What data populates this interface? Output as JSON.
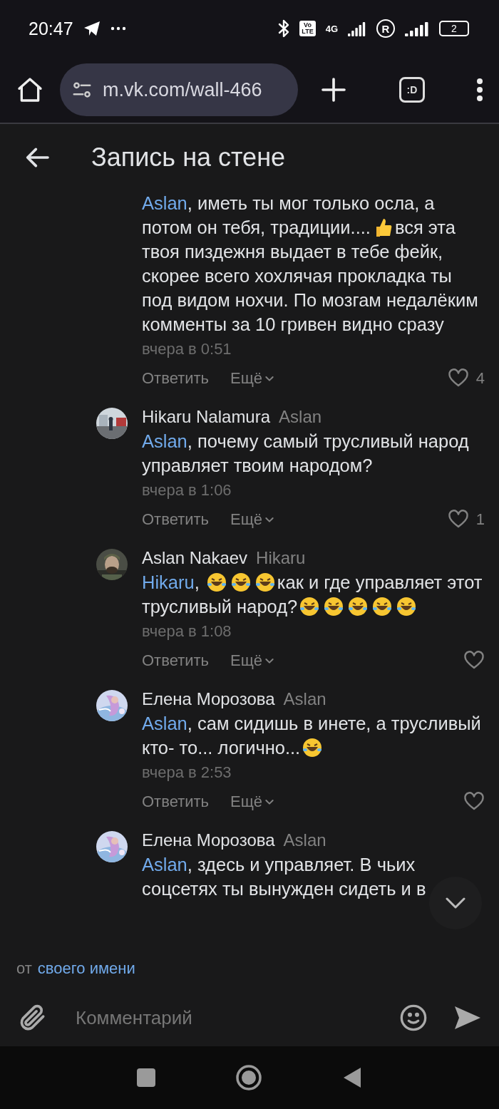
{
  "status_bar": {
    "time": "20:47",
    "volte": [
      "Vo",
      "LTE"
    ],
    "network": "4G",
    "roaming": "R",
    "battery": "2"
  },
  "browser": {
    "url": "m.vk.com/wall-466",
    "tabs_label": ":D"
  },
  "header": {
    "title": "Запись на стене"
  },
  "comments": [
    {
      "body": [
        {
          "kind": "mention",
          "text": "Aslan"
        },
        {
          "kind": "text",
          "text": ", иметь ты мог только осла, а потом он тебя, традиции...."
        },
        {
          "kind": "thumbs"
        },
        {
          "kind": "text",
          "text": "вся эта твоя пиздежня выдает в тебе фейк, скорее всего хохлячая прокладка ты под видом нохчи. По мозгам недалёким комменты за 10 гривен видно сразу"
        }
      ],
      "time": "вчера в 0:51",
      "reply": "Ответить",
      "more": "Ещё",
      "likes": "4",
      "liked": false
    },
    {
      "author": "Hikaru Nalamura",
      "reply_to": "Aslan",
      "avatar": {
        "kind": "picture"
      },
      "body": [
        {
          "kind": "mention",
          "text": "Aslan"
        },
        {
          "kind": "text",
          "text": ", почему самый трусливый народ управляет твоим народом?"
        }
      ],
      "time": "вчера в 1:06",
      "reply": "Ответить",
      "more": "Ещё",
      "likes": "1",
      "liked": false
    },
    {
      "author": "Aslan Nakaev",
      "reply_to": "Hikaru",
      "avatar": {
        "kind": "picture"
      },
      "body": [
        {
          "kind": "mention",
          "text": "Hikaru"
        },
        {
          "kind": "text",
          "text": ", "
        },
        {
          "kind": "laugh"
        },
        {
          "kind": "laugh"
        },
        {
          "kind": "laugh"
        },
        {
          "kind": "text",
          "text": "как и где управляет этот трусливый народ?"
        },
        {
          "kind": "laugh"
        },
        {
          "kind": "laugh"
        },
        {
          "kind": "laugh"
        },
        {
          "kind": "laugh"
        },
        {
          "kind": "laugh"
        }
      ],
      "time": "вчера в 1:08",
      "reply": "Ответить",
      "more": "Ещё",
      "liked": false
    },
    {
      "author": "Елена Морозова",
      "reply_to": "Aslan",
      "avatar": {
        "kind": "picture"
      },
      "body": [
        {
          "kind": "mention",
          "text": "Aslan"
        },
        {
          "kind": "text",
          "text": ", сам сидишь в инете, а трусливый кто- то... логично..."
        },
        {
          "kind": "laugh"
        }
      ],
      "time": "вчера в 2:53",
      "reply": "Ответить",
      "more": "Ещё",
      "liked": false
    },
    {
      "author": "Елена Морозова",
      "reply_to": "Aslan",
      "avatar": {
        "kind": "picture"
      },
      "body": [
        {
          "kind": "mention",
          "text": "Aslan"
        },
        {
          "kind": "text",
          "text": ", здесь и управляет. В чьих соцсетях ты вынужден сидеть и в"
        }
      ]
    }
  ],
  "composer": {
    "as_prefix": "от",
    "as_link": "своего имени",
    "placeholder": "Комментарий"
  }
}
